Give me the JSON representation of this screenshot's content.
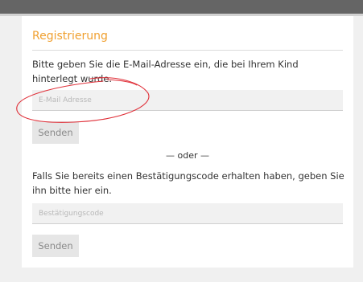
{
  "title": "Registrierung",
  "email_section": {
    "instruction": "Bitte geben Sie die E-Mail-Adresse ein, die bei Ihrem Kind hinterlegt wurde.",
    "input_placeholder": "E-Mail Adresse",
    "submit_label": "Senden"
  },
  "divider_text": "— oder —",
  "code_section": {
    "instruction": "Falls Sie bereits einen Bestätigungscode erhalten haben, geben Sie ihn bitte hier ein.",
    "input_placeholder": "Bestätigungscode",
    "submit_label": "Senden"
  },
  "colors": {
    "accent": "#f0a030",
    "annotation": "#e0313a"
  }
}
